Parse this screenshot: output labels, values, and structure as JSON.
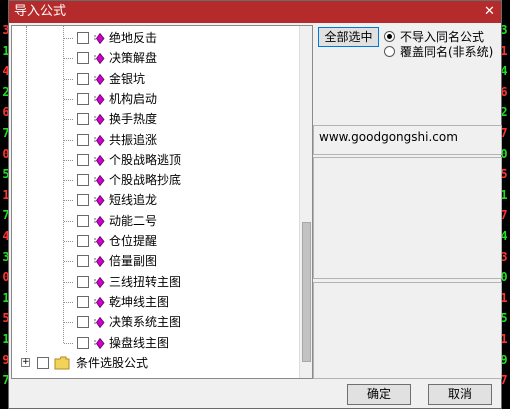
{
  "dialog": {
    "title": "导入公式",
    "close_glyph": "✕"
  },
  "background_digits": {
    "left": [
      "3",
      "1",
      "4",
      "2",
      "6",
      "7",
      "0",
      "5",
      "1",
      "7",
      "4",
      "3",
      "0",
      "1",
      "5",
      "1",
      "9",
      "7"
    ],
    "right": [
      "3",
      "1",
      "4",
      "6",
      "2",
      "7",
      "0",
      "5",
      "1",
      "7",
      "4",
      "3",
      "0",
      "1",
      "5",
      "1",
      "9",
      "7"
    ]
  },
  "tree": {
    "items": [
      {
        "label": "绝地反击"
      },
      {
        "label": "决策解盘"
      },
      {
        "label": "金银坑"
      },
      {
        "label": "机构启动"
      },
      {
        "label": "换手热度"
      },
      {
        "label": "共振追涨"
      },
      {
        "label": "个股战略逃顶"
      },
      {
        "label": "个股战略抄底"
      },
      {
        "label": "短线追龙"
      },
      {
        "label": "动能二号"
      },
      {
        "label": "仓位提醒"
      },
      {
        "label": "倍量副图"
      },
      {
        "label": "三线扭转主图"
      },
      {
        "label": "乾坤线主图"
      },
      {
        "label": "决策系统主图"
      },
      {
        "label": "操盘线主图"
      }
    ],
    "folder": {
      "label": "条件选股公式",
      "expander": "+"
    }
  },
  "options": {
    "select_all_label": "全部选中",
    "radio_no_import": "不导入同名公式",
    "radio_overwrite": "覆盖同名(非系统)",
    "selected": "no_import"
  },
  "info": {
    "url": "www.goodgongshi.com"
  },
  "footer": {
    "ok_label": "确定",
    "cancel_label": "取消"
  },
  "colors": {
    "titlebar": "#b52a2a",
    "formula_icon": "#cc00cc",
    "folder_icon": "#f2d35a"
  }
}
